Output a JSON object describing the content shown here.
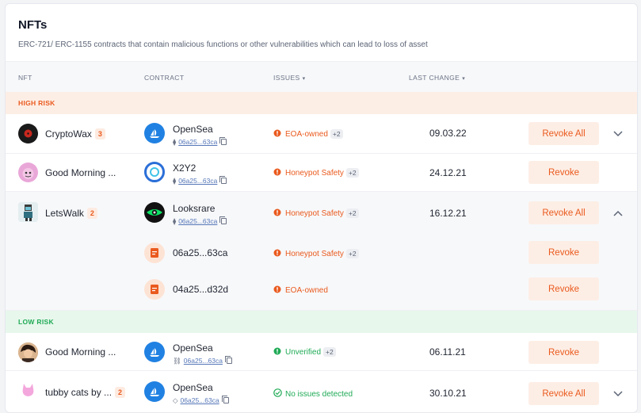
{
  "header": {
    "title": "NFTs",
    "subtitle": "ERC-721/ ERC-1155 contracts that contain malicious functions or other vulnerabilities which can lead to loss of asset"
  },
  "columns": {
    "nft": "NFT",
    "contract": "CONTRACT",
    "issues": "ISSUES",
    "last_change": "LAST CHANGE",
    "sort_caret": "▾"
  },
  "sections": {
    "high_risk": "HIGH RISK",
    "low_risk": "LOW RISK"
  },
  "rows": [
    {
      "nft": "CryptoWax",
      "count": "3",
      "contract": "OpenSea",
      "address": "06a25...63ca",
      "chain_icon": "ethereum-icon",
      "issue": "EOA-owned",
      "issue_extra": "+2",
      "date": "09.03.22",
      "action": "Revoke All",
      "chevron": "down"
    },
    {
      "nft": "Good Morning ...",
      "contract": "X2Y2",
      "address": "06a25...63ca",
      "chain_icon": "ethereum-icon",
      "issue": "Honeypot Safety",
      "issue_extra": "+2",
      "date": "24.12.21",
      "action": "Revoke"
    },
    {
      "nft": "LetsWalk",
      "count": "2",
      "contract": "Looksrare",
      "address": "06a25...63ca",
      "chain_icon": "ethereum-icon",
      "issue": "Honeypot Safety",
      "issue_extra": "+2",
      "date": "16.12.21",
      "action": "Revoke All",
      "chevron": "up",
      "sub_rows": [
        {
          "address": "06a25...63ca",
          "issue": "Honeypot Safety",
          "issue_extra": "+2",
          "action": "Revoke"
        },
        {
          "address": "04a25...d32d",
          "issue": "EOA-owned",
          "action": "Revoke"
        }
      ]
    },
    {
      "nft": "Good Morning ...",
      "contract": "OpenSea",
      "address": "06a25...63ca",
      "chain_icon": "link-chain-icon",
      "issue": "Unverified",
      "issue_extra": "+2",
      "date": "06.11.21",
      "action": "Revoke"
    },
    {
      "nft": "tubby cats by ...",
      "count": "2",
      "contract": "OpenSea",
      "address": "06a25...63ca",
      "chain_icon": "bnb-chain-icon",
      "issue": "No issues detected",
      "date": "30.10.21",
      "action": "Revoke All",
      "chevron": "down"
    }
  ],
  "colors": {
    "accent": "#ea5a1e",
    "accent_bg": "#fdeee5",
    "low_risk": "#1faa55",
    "low_risk_bg": "#e7f7ec",
    "opensea": "#2081e2"
  }
}
